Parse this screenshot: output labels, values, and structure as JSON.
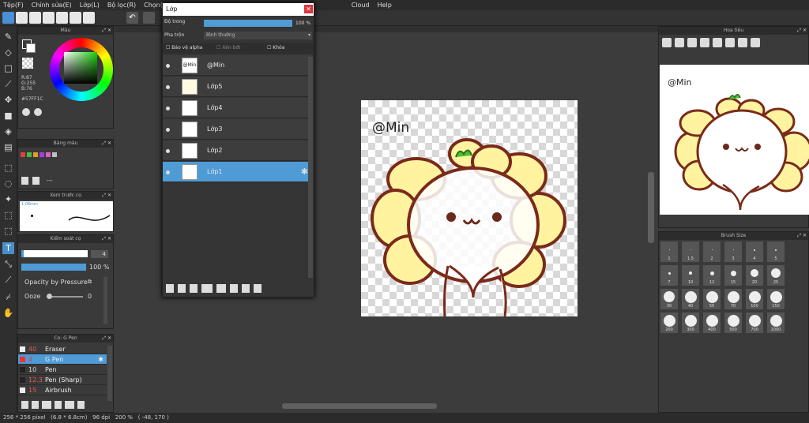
{
  "menu": [
    "Tệp(F)",
    "Chỉnh sửa(E)",
    "Lớp(L)",
    "Bộ lọc(R)",
    "Chọn(S)",
    "Ch",
    "Cloud",
    "Help"
  ],
  "colors": {
    "accent": "#4e9bd6",
    "fg_color": "#57FF1C",
    "close": "#d9363e"
  },
  "color_panel": {
    "title": "Màu",
    "r": "R:87",
    "g": "G:255",
    "b": "B:76",
    "hex": "#57FF1C"
  },
  "swatch_panel": {
    "title": "Bảng màu",
    "dash": "---",
    "swatches": [
      "#e04040",
      "#e0a020",
      "#40c040",
      "#a040e0",
      "#e060c0",
      "#c0c0c0"
    ]
  },
  "brush_preview": {
    "title": "Xem trước cọ",
    "size": "1.06mm"
  },
  "brush_control": {
    "title": "Kiểm soát cọ",
    "size_value": "4",
    "opacity_value": "100 %",
    "pressure_label": "Opacity by Pressure",
    "ooze_label": "Ooze",
    "ooze_value": "0"
  },
  "brush_list": {
    "title": "Cọ: G Pen",
    "items": [
      {
        "size": "40",
        "name": "Eraser"
      },
      {
        "size": "4",
        "name": "G Pen"
      },
      {
        "size": "10",
        "name": "Pen"
      },
      {
        "size": "12.3",
        "name": "Pen (Sharp)"
      },
      {
        "size": "15",
        "name": "Airbrush"
      }
    ]
  },
  "layer_window": {
    "title": "Lớp",
    "opacity_label": "Độ trong",
    "opacity_value": "100 %",
    "blend_label": "Pha trộn",
    "blend_value": "Bình thường",
    "protect_alpha": "Bảo vệ alpha",
    "clipping": "Xén bớt",
    "lock": "Khóa",
    "layers": [
      {
        "name": "@Min",
        "thumb_text": "@Min"
      },
      {
        "name": "Lớp5"
      },
      {
        "name": "Lớp4"
      },
      {
        "name": "Lớp3"
      },
      {
        "name": "Lớp2"
      },
      {
        "name": "Lớp1"
      }
    ]
  },
  "canvas": {
    "watermark": "@Min"
  },
  "navigator": {
    "title": "Hoa tiêu",
    "watermark": "@Min"
  },
  "brush_size": {
    "title": "Brush Size",
    "sizes": [
      "1",
      "1.5",
      "2",
      "3",
      "4",
      "5",
      "7",
      "10",
      "12",
      "15",
      "20",
      "25",
      "30",
      "40",
      "50",
      "70",
      "100",
      "150",
      "200",
      "300",
      "400",
      "500",
      "700",
      "1000"
    ]
  },
  "status": {
    "text": "256 * 256 pixel   (6.8 * 6.8cm)   96 dpi   200 %   ( -48, 170 )"
  }
}
